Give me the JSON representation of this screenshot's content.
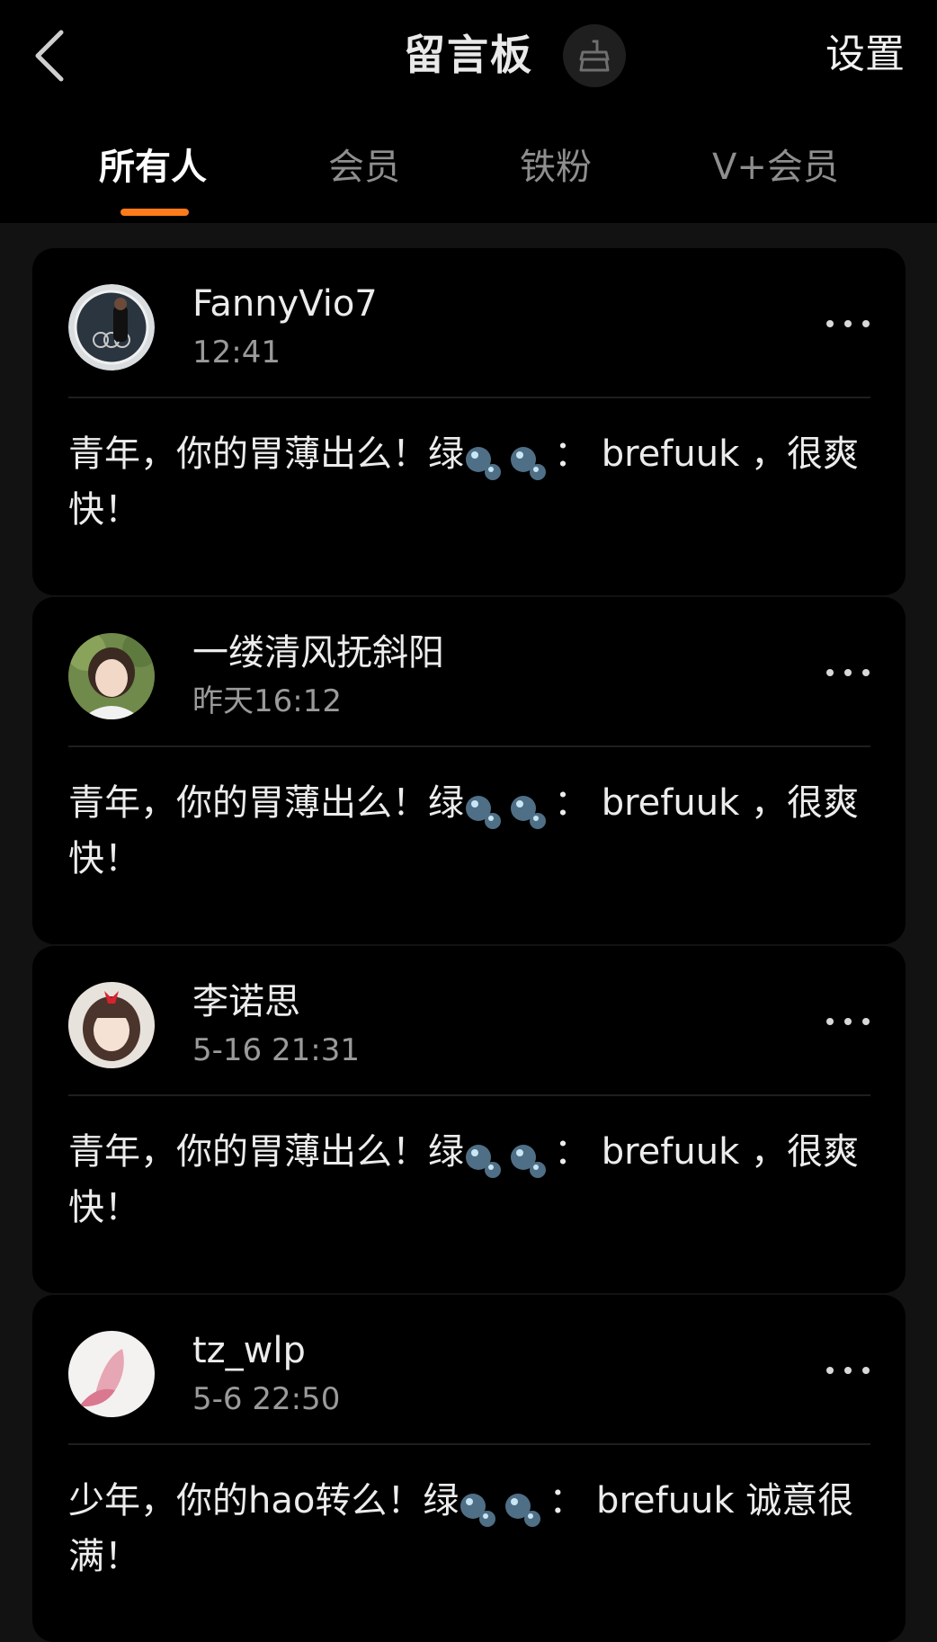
{
  "header": {
    "title": "留言板",
    "settings_label": "设置",
    "back_icon": "chevron-left-icon",
    "clean_icon": "broom-icon"
  },
  "tabs": [
    {
      "label": "所有人",
      "active": true
    },
    {
      "label": "会员",
      "active": false
    },
    {
      "label": "铁粉",
      "active": false
    },
    {
      "label": "V+会员",
      "active": false
    }
  ],
  "colors": {
    "accent": "#ff7a1a",
    "background": "#121212",
    "card": "#000000",
    "secondary_text": "#9a9a9a"
  },
  "posts": [
    {
      "username": "FannyVio7",
      "time": "12:41",
      "msg_pre": "青年，你的胃薄出么！绿",
      "msg_post": "：  brefuuk ，很爽快！"
    },
    {
      "username": "一缕清风抚斜阳",
      "time": "昨天16:12",
      "msg_pre": "青年，你的胃薄出么！绿",
      "msg_post": "：  brefuuk ，很爽快！"
    },
    {
      "username": "李诺思",
      "time": "5-16 21:31",
      "msg_pre": "青年，你的胃薄出么！绿",
      "msg_post": "：  brefuuk ，很爽快！"
    },
    {
      "username": "tz_wlp",
      "time": "5-6 22:50",
      "msg_pre": "少年，你的hao转么！绿",
      "msg_post": "：  brefuuk 诚意很满！"
    }
  ]
}
